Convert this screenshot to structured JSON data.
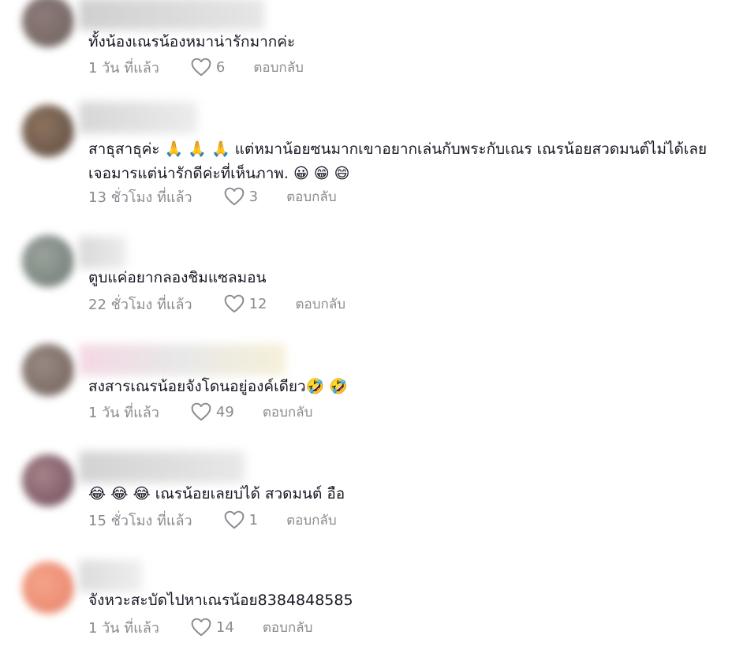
{
  "colors": {
    "text": "#161823",
    "meta": "#8a8b91"
  },
  "comments": [
    {
      "text": "ทั้งน้องเณรน้องหมาน่ารักมากค่ะ",
      "time": "1 วัน ที่แล้ว",
      "likes": "6",
      "reply": "ตอบกลับ"
    },
    {
      "text": "สาธุสาธุค่ะ 🙏 🙏 🙏 แต่หมาน้อยซนมากเขาอยากเล่นกับพระกับเณร เณรน้อยสวดมนต์ไม่ได้เลยเจอมารแต่น่ารักดีค่ะที่เห็นภาพ. 😀 😁 😄",
      "time": "13 ชั่วโมง ที่แล้ว",
      "likes": "3",
      "reply": "ตอบกลับ"
    },
    {
      "text": "ตูบแค่อยากลองชิมแซลมอน",
      "time": "22 ชั่วโมง ที่แล้ว",
      "likes": "12",
      "reply": "ตอบกลับ"
    },
    {
      "text": "สงสารเณรน้อยจังโดนอยู่องค์เดียว🤣 🤣",
      "time": "1 วัน ที่แล้ว",
      "likes": "49",
      "reply": "ตอบกลับ"
    },
    {
      "text": "😂 😂 😂 เณรน้อยเลยบ่ได้ สวดมนต์ อือ",
      "time": "15 ชั่วโมง ที่แล้ว",
      "likes": "1",
      "reply": "ตอบกลับ"
    },
    {
      "text": "จังหวะสะบัดไปหาเณรน้อย8384848585",
      "time": "1 วัน ที่แล้ว",
      "likes": "14",
      "reply": "ตอบกลับ"
    }
  ]
}
